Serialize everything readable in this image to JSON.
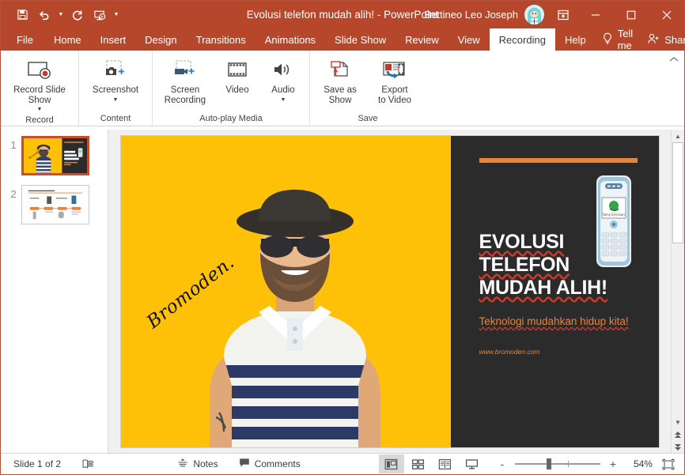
{
  "titlebar": {
    "quick_access": [
      {
        "name": "save-icon",
        "label": "Save"
      },
      {
        "name": "undo-icon",
        "label": "Undo"
      },
      {
        "name": "redo-icon",
        "label": "Redo"
      },
      {
        "name": "start-presentation-icon",
        "label": "Start From Beginning"
      },
      {
        "name": "customize-qat-icon",
        "label": "Customize Quick Access Toolbar"
      }
    ],
    "document_title": "Evolusi telefon mudah alih!",
    "separator": "-",
    "app_name": "PowerPoint",
    "account_name": "Bettineo Leo Joseph",
    "ribbon_display_options": "Ribbon Display Options",
    "minimize": "Minimize",
    "maximize": "Maximize",
    "close": "Close"
  },
  "tabs": [
    {
      "label": "File",
      "active": false
    },
    {
      "label": "Home",
      "active": false
    },
    {
      "label": "Insert",
      "active": false
    },
    {
      "label": "Design",
      "active": false
    },
    {
      "label": "Transitions",
      "active": false
    },
    {
      "label": "Animations",
      "active": false
    },
    {
      "label": "Slide Show",
      "active": false
    },
    {
      "label": "Review",
      "active": false
    },
    {
      "label": "View",
      "active": false
    },
    {
      "label": "Recording",
      "active": true
    },
    {
      "label": "Help",
      "active": false
    }
  ],
  "tellme_label": "Tell me",
  "share_label": "Share",
  "ribbon": {
    "collapse_label": "^",
    "groups": [
      {
        "label": "Record",
        "buttons": [
          {
            "label_line1": "Record Slide",
            "label_line2": "Show",
            "has_dropdown": true,
            "icon": "record-slide-show-icon"
          }
        ]
      },
      {
        "label": "Content",
        "buttons": [
          {
            "label_line1": "Screenshot",
            "label_line2": "",
            "has_dropdown": true,
            "icon": "screenshot-icon"
          }
        ]
      },
      {
        "label": "Auto-play Media",
        "buttons": [
          {
            "label_line1": "Screen",
            "label_line2": "Recording",
            "has_dropdown": false,
            "icon": "screen-recording-icon"
          },
          {
            "label_line1": "Video",
            "label_line2": "",
            "has_dropdown": false,
            "icon": "video-icon"
          },
          {
            "label_line1": "Audio",
            "label_line2": "",
            "has_dropdown": true,
            "icon": "audio-icon"
          }
        ]
      },
      {
        "label": "Save",
        "buttons": [
          {
            "label_line1": "Save as",
            "label_line2": "Show",
            "has_dropdown": false,
            "icon": "save-as-show-icon"
          },
          {
            "label_line1": "Export",
            "label_line2": "to Video",
            "has_dropdown": false,
            "icon": "export-to-video-icon"
          }
        ]
      }
    ]
  },
  "thumbnails": [
    {
      "number": "1",
      "selected": true
    },
    {
      "number": "2",
      "selected": false
    }
  ],
  "slide": {
    "brand_script": "Bromoden.",
    "title_lines": [
      "EVOLUSI",
      "TELEFON",
      "MUDAH ALIH!"
    ],
    "subtitle": "Teknologi mudahkan hidup kita!",
    "url": "www.bromoden.com",
    "bg_yellow": "#ffc107",
    "panel_dark": "#2b2b2b",
    "accent_orange": "#e8833a"
  },
  "status": {
    "slide_counter": "Slide 1 of 2",
    "language_icon": "proofing-language-icon",
    "notes_label": "Notes",
    "comments_label": "Comments",
    "views": [
      {
        "name": "normal-view",
        "label": "Normal",
        "active": true
      },
      {
        "name": "slide-sorter-view",
        "label": "Slide Sorter",
        "active": false
      },
      {
        "name": "reading-view",
        "label": "Reading View",
        "active": false
      },
      {
        "name": "slide-show-view",
        "label": "Slide Show",
        "active": false
      }
    ],
    "zoom_out": "-",
    "zoom_in": "+",
    "zoom_percent": "54%",
    "fit_label": "Fit slide to current window"
  },
  "colors": {
    "ribbon_accent": "#b7472a",
    "slide_yellow": "#ffc107",
    "slide_dark": "#2b2b2b",
    "slide_orange": "#e8833a"
  }
}
